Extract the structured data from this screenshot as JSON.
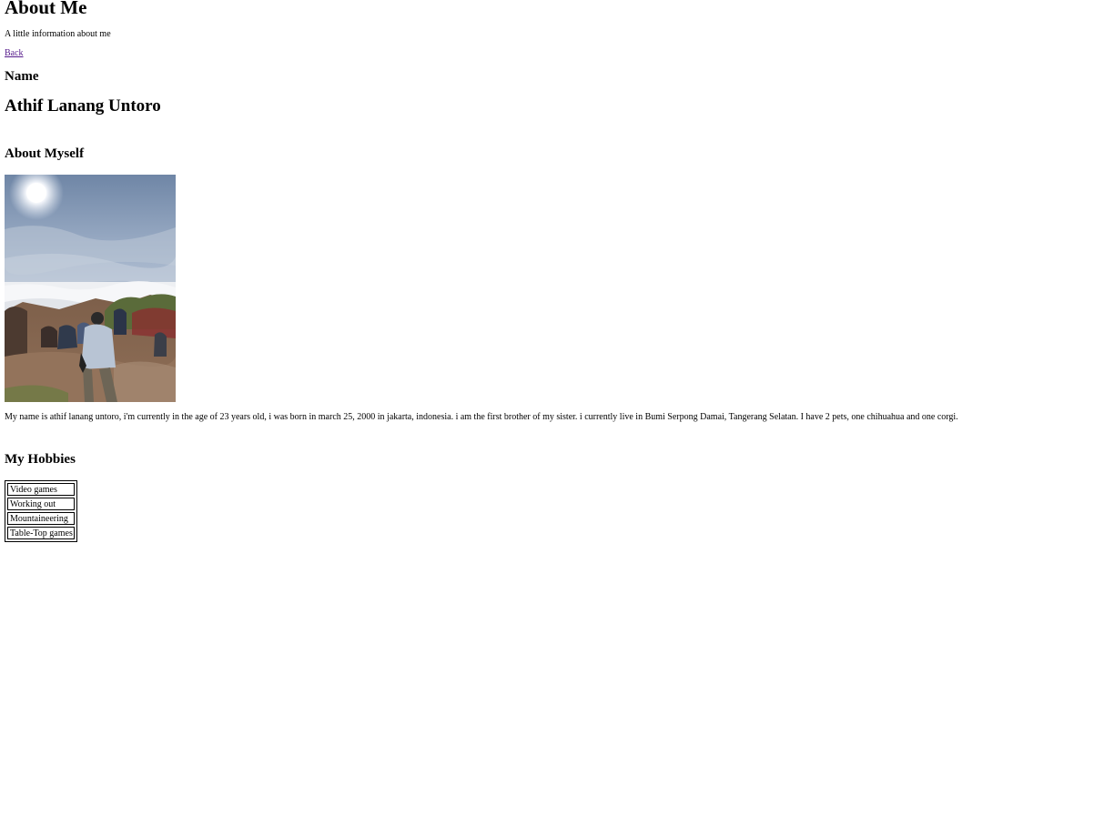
{
  "header": {
    "title": "About Me",
    "subtitle": "A little information about me",
    "back_link": "Back"
  },
  "name_section": {
    "heading": "Name",
    "value": "Athif Lanang Untoro"
  },
  "about_section": {
    "heading": "About Myself",
    "photo_alt": "Photo on a mountain summit above the clouds",
    "bio": "My name is athif lanang untoro, i'm currently in the age of 23 years old, i was born in march 25, 2000 in jakarta, indonesia. i am the first brother of my sister. i currently live in Bumi Serpong Damai, Tangerang Selatan. I have 2 pets, one chihuahua and one corgi."
  },
  "hobbies_section": {
    "heading": "My Hobbies",
    "items": [
      "Video games",
      "Working out",
      "Mountaineering",
      "Table-Top games"
    ]
  }
}
